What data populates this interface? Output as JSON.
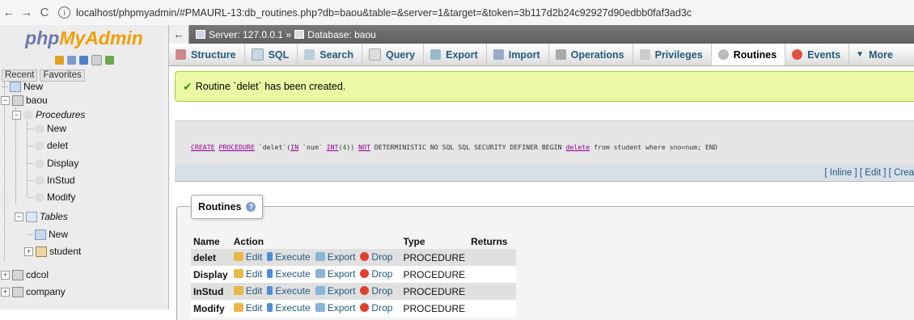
{
  "browser": {
    "back": "←",
    "forward": "→",
    "reload": "C",
    "url": "localhost/phpmyadmin/#PMAURL-13:db_routines.php?db=baou&table=&server=1&target=&token=3b117d2b24c92927d90edbb0faf3ad3c"
  },
  "sidebar": {
    "logo_php": "php",
    "logo_myadmin": "MyAdmin",
    "tab_recent": "Recent",
    "tab_favorites": "Favorites",
    "new_label": "New",
    "db_baou": "baou",
    "procedures_label": "Procedures",
    "proc_new": "New",
    "procedures": [
      "delet",
      "Display",
      "InStud",
      "Modify"
    ],
    "tables_label": "Tables",
    "tables_new": "New",
    "table_student": "student",
    "db_cdcol": "cdcol",
    "db_company": "company"
  },
  "breadcrumb": {
    "server": "Server: 127.0.0.1 »",
    "database": "Database: baou"
  },
  "menu": {
    "tabs": [
      "Structure",
      "SQL",
      "Search",
      "Query",
      "Export",
      "Import",
      "Operations",
      "Privileges",
      "Routines",
      "Events",
      "More"
    ],
    "active": "Routines"
  },
  "notice": "Routine `delet` has been created.",
  "sql": {
    "p1": "CREATE",
    "p2": "PROCEDURE",
    "p3": " `delet`(",
    "p4": "IN",
    "p5": " `num` ",
    "p6": "INT",
    "p7": "(",
    "p8": "4",
    "p9": ")) ",
    "p10": "NOT",
    "p11": " DETERMINISTIC NO SQL SQL SECURITY DEFINER BEGIN ",
    "p12": "delete",
    "p13": " from student where sno=num; END"
  },
  "sql_links": "[ Inline ] [ Edit ] [ Crea",
  "routines": {
    "legend": "Routines",
    "headers": [
      "Name",
      "Action",
      "Type",
      "Returns"
    ],
    "rows": [
      {
        "name": "delet",
        "edit": "Edit",
        "execute": "Execute",
        "export": "Export",
        "drop": "Drop",
        "type": "PROCEDURE",
        "returns": ""
      },
      {
        "name": "Display",
        "edit": "Edit",
        "execute": "Execute",
        "export": "Export",
        "drop": "Drop",
        "type": "PROCEDURE",
        "returns": ""
      },
      {
        "name": "InStud",
        "edit": "Edit",
        "execute": "Execute",
        "export": "Export",
        "drop": "Drop",
        "type": "PROCEDURE",
        "returns": ""
      },
      {
        "name": "Modify",
        "edit": "Edit",
        "execute": "Execute",
        "export": "Export",
        "drop": "Drop",
        "type": "PROCEDURE",
        "returns": ""
      }
    ]
  },
  "colors": {
    "link": "#235a81",
    "notice_bg": "#ebf8a4",
    "logo_php": "#6c78af",
    "logo_myadmin": "#f29e00"
  }
}
